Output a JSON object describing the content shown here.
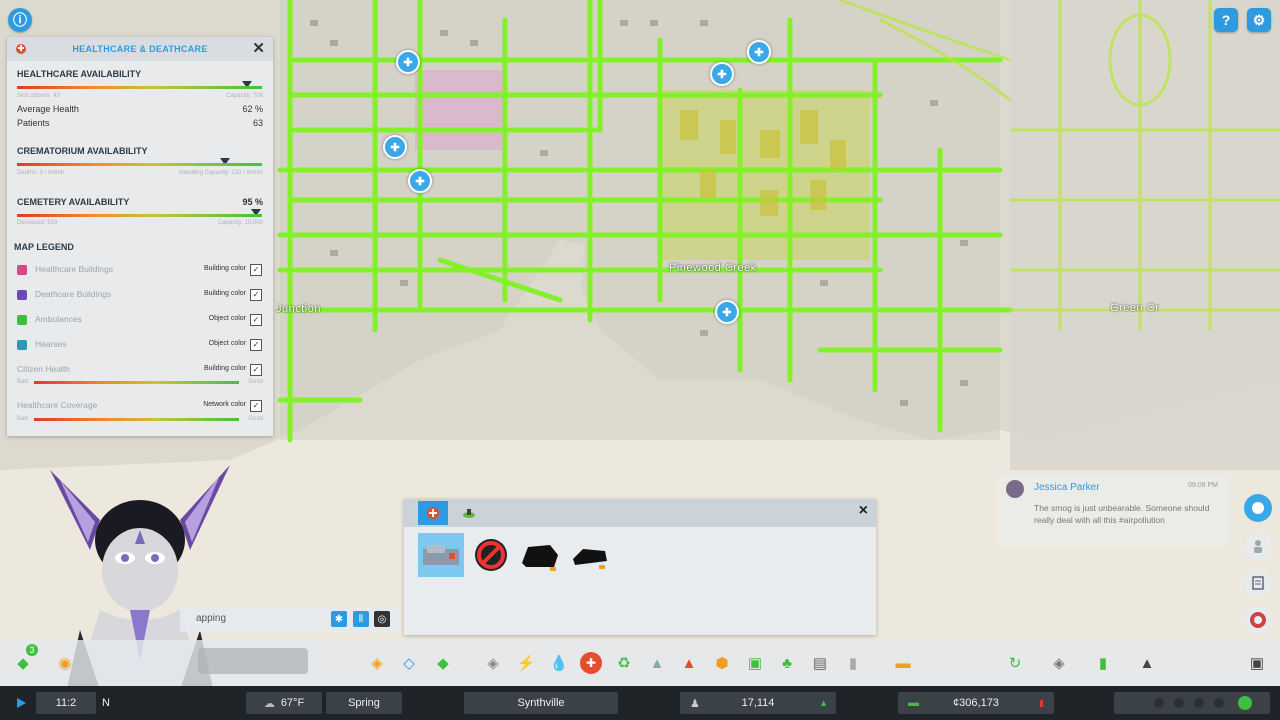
{
  "map": {
    "labels": {
      "pinewood": "Pinewood Creek",
      "junction": "Junction",
      "green": "Green Cr"
    }
  },
  "info_panel": {
    "title": "HEALTHCARE & DEATHCARE",
    "healthcare": {
      "title": "HEALTHCARE AVAILABILITY",
      "sub_left": "Sick citizens: 43",
      "sub_right": "Capacity: 708",
      "avg_health_label": "Average Health",
      "avg_health_value": "62 %",
      "patients_label": "Patients",
      "patients_value": "63"
    },
    "crematorium": {
      "title": "CREMATORIUM AVAILABILITY",
      "sub_left": "Deaths: 3 / month",
      "sub_right": "Handling Capacity: 120 / month"
    },
    "cemetery": {
      "title": "CEMETERY AVAILABILITY",
      "value": "95 %",
      "sub_left": "Deceased: 519",
      "sub_right": "Capacity: 10,000"
    },
    "legend": {
      "title": "MAP LEGEND",
      "items": [
        {
          "label": "Healthcare Buildings",
          "mode": "Building color",
          "color": "#d04a8a"
        },
        {
          "label": "Deathcare Buildings",
          "mode": "Building color",
          "color": "#6a4ab8"
        },
        {
          "label": "Ambulances",
          "mode": "Object color",
          "color": "#3fbf3f"
        },
        {
          "label": "Hearses",
          "mode": "Object color",
          "color": "#2a9ab8"
        },
        {
          "label": "Citizen Health",
          "mode": "Building color",
          "color": ""
        },
        {
          "label": "Healthcare Coverage",
          "mode": "Network color",
          "color": ""
        }
      ],
      "grad_lo": "Bad",
      "grad_hi": "Good",
      "check": "✓"
    }
  },
  "tool_panel": {
    "close": "×"
  },
  "chat": {
    "name": "Jessica Parker",
    "time": "09:09 PM",
    "message": "The smog is just unbearable. Someone should really deal with all this #airpollution"
  },
  "snap": {
    "label": "apping"
  },
  "toolbar": {
    "badge": "3"
  },
  "status": {
    "time": "11:2",
    "n_label": "N",
    "temperature": "67°F",
    "season": "Spring",
    "city": "Synthville",
    "population": "17,114",
    "money": "¢306,173"
  },
  "colors": {
    "road": "#84f02a",
    "accent": "#2e9be0"
  }
}
